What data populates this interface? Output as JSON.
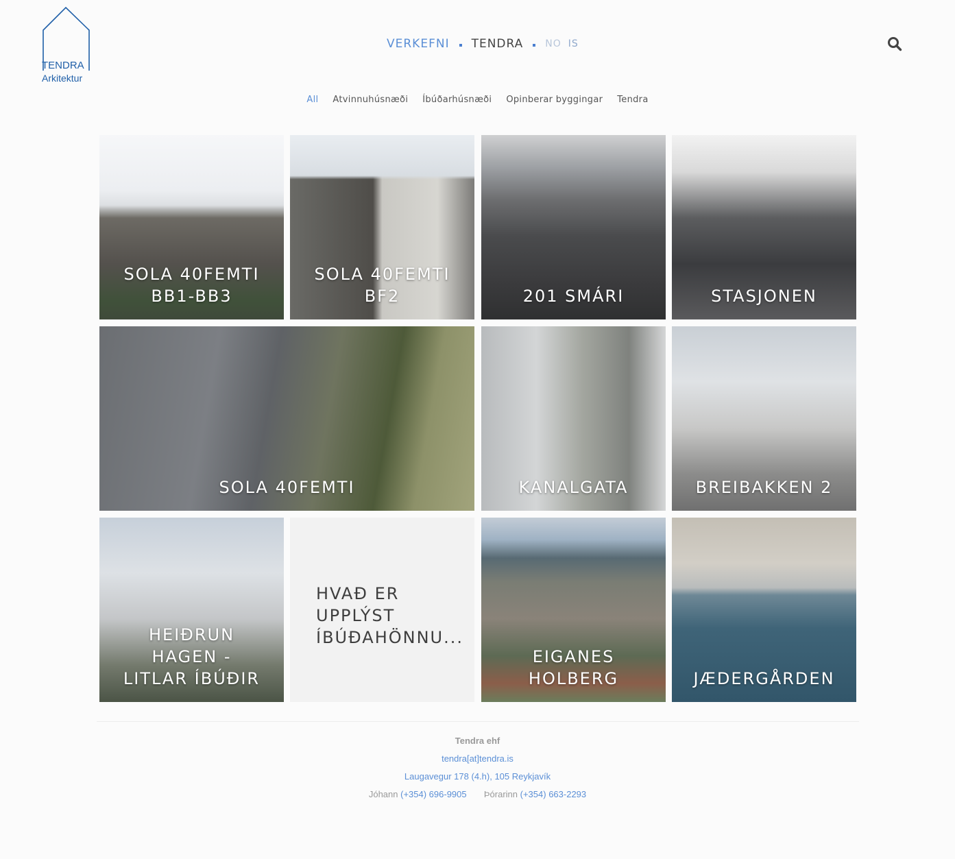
{
  "logo": {
    "line1": "TENDRA",
    "line2": "Arkitektur",
    "icon": "house-outline-icon",
    "color": "#1f5fa8"
  },
  "nav": {
    "items": [
      {
        "label": "VERKEFNI",
        "active": true
      },
      {
        "label": "TENDRA",
        "active": false
      }
    ],
    "languages": [
      "NO",
      "IS"
    ],
    "accent": "#5b8fd6",
    "search_icon": "search-icon"
  },
  "filters": [
    {
      "label": "All",
      "active": true
    },
    {
      "label": "Atvinnuhúsnæði",
      "active": false
    },
    {
      "label": "Íbúðarhúsnæði",
      "active": false
    },
    {
      "label": "Opinberar byggingar",
      "active": false
    },
    {
      "label": "Tendra",
      "active": false
    }
  ],
  "projects": [
    {
      "title": "SOLA 40FEMTI BB1-BB3"
    },
    {
      "title": "SOLA 40FEMTI BF2"
    },
    {
      "title": "201 SMÁRI"
    },
    {
      "title": "STASJONEN"
    },
    {
      "title": "SOLA 40FEMTI"
    },
    {
      "title": "KANALGATA"
    },
    {
      "title": "BREIBAKKEN 2"
    },
    {
      "title": "HEIÐRUN HAGEN - LITLAR ÍBÚÐIR"
    },
    {
      "title": "HVAÐ ER UPPLÝST ÍBÚÐAHÖNNU..."
    },
    {
      "title": "EIGANES HOLBERG"
    },
    {
      "title": "JÆDERGÅRDEN"
    }
  ],
  "footer": {
    "company": "Tendra ehf",
    "email": "tendra[at]tendra.is",
    "address": "Laugavegur 178 (4.h), 105 Reykjavík",
    "contacts": [
      {
        "name": "Jóhann",
        "phone": "(+354) 696-9905"
      },
      {
        "name": "Þórarinn",
        "phone": "(+354) 663-2293"
      }
    ]
  }
}
